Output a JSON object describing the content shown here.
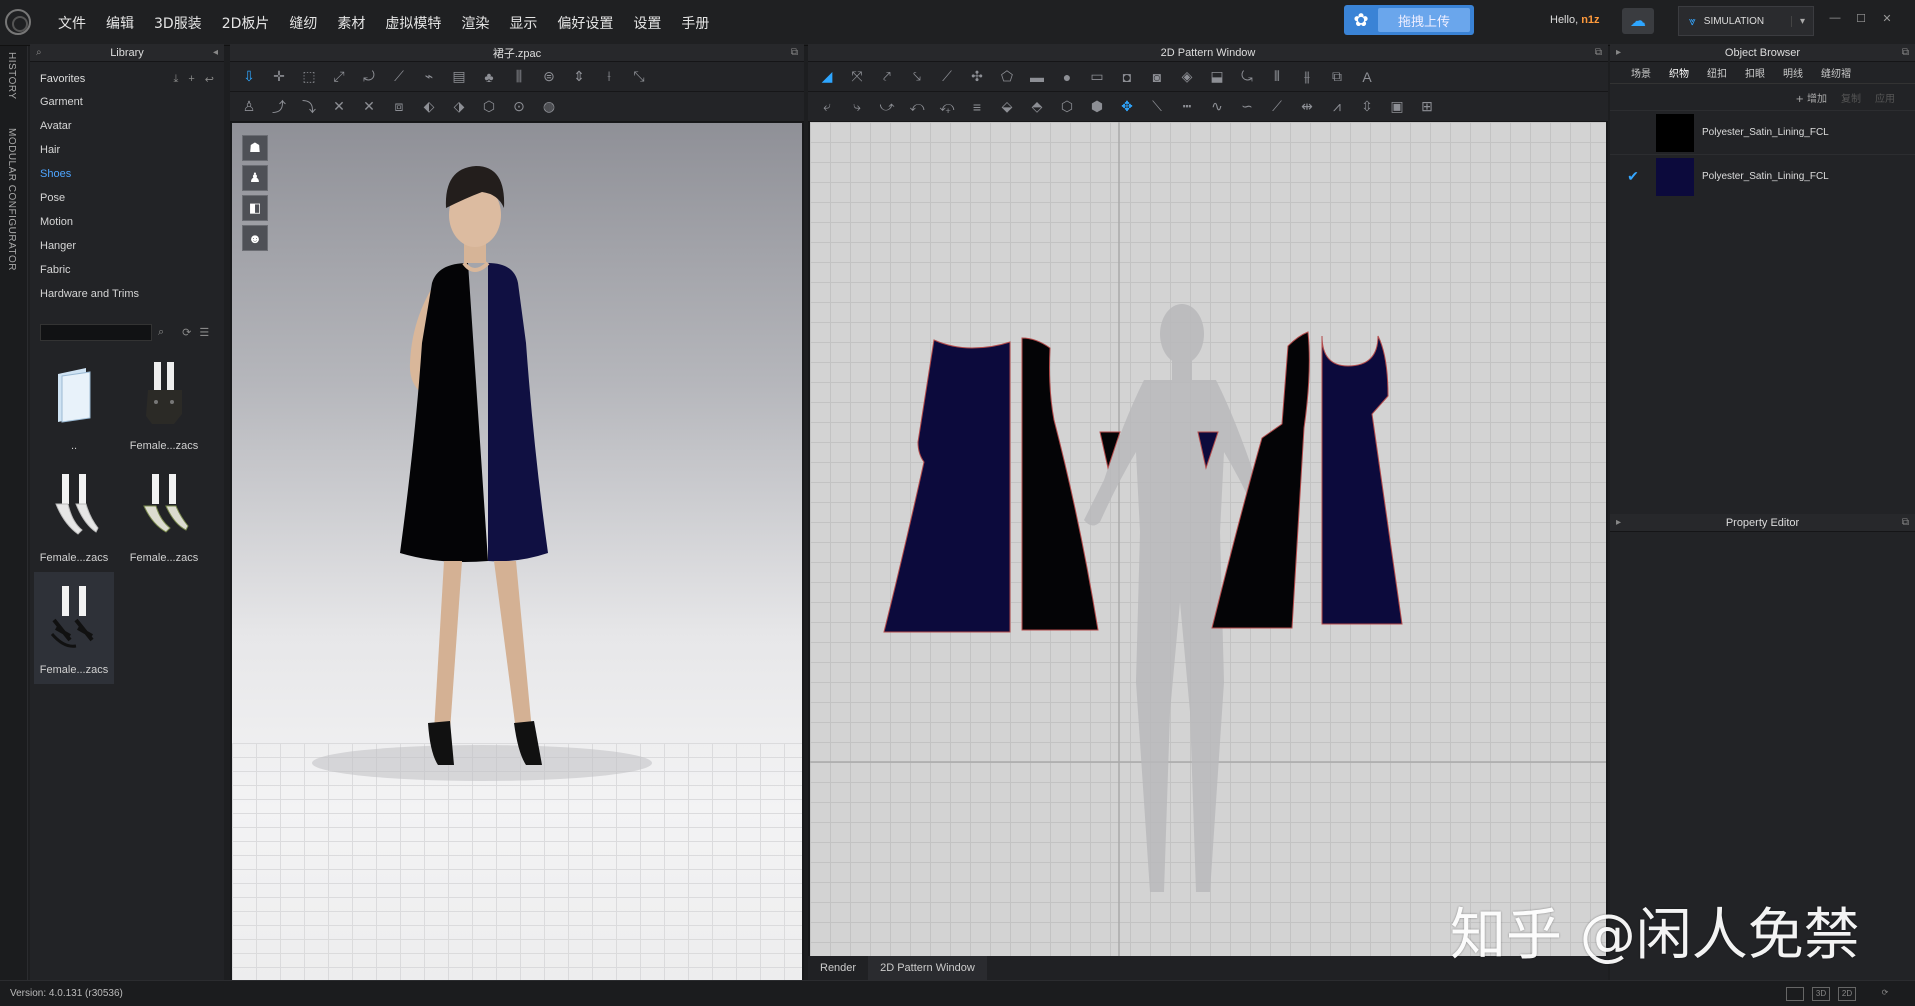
{
  "app": {
    "menu": [
      "文件",
      "编辑",
      "3D服装",
      "2D板片",
      "缝纫",
      "素材",
      "虚拟模特",
      "渲染",
      "显示",
      "偏好设置",
      "设置",
      "手册"
    ],
    "upload_label": "拖拽上传",
    "hello_prefix": "Hello,",
    "user": "n1z",
    "simulation_label": "SIMULATION",
    "window_controls": [
      "—",
      "☐",
      "✕"
    ]
  },
  "vertical_tabs": [
    "HISTORY",
    "MODULAR CONFIGURATOR"
  ],
  "library": {
    "title": "Library",
    "favorites_label": "Favorites",
    "items": [
      {
        "label": "Garment"
      },
      {
        "label": "Avatar"
      },
      {
        "label": "Hair"
      },
      {
        "label": "Shoes",
        "selected": true
      },
      {
        "label": "Pose"
      },
      {
        "label": "Motion"
      },
      {
        "label": "Hanger"
      },
      {
        "label": "Fabric"
      },
      {
        "label": "Hardware and Trims"
      }
    ],
    "search_value": "",
    "thumbnails": [
      {
        "caption": "..",
        "kind": "folder",
        "selected": false
      },
      {
        "caption": "Female...zacs",
        "kind": "boot",
        "selected": false
      },
      {
        "caption": "Female...zacs",
        "kind": "white-heel",
        "selected": false
      },
      {
        "caption": "Female...zacs",
        "kind": "green-heel",
        "selected": false
      },
      {
        "caption": "Female...zacs",
        "kind": "black-sandal",
        "selected": true
      }
    ]
  },
  "viewport3d": {
    "title": "裙子.zpac"
  },
  "pattern_window": {
    "title": "2D Pattern Window",
    "tabs": [
      {
        "label": "Render",
        "active": false
      },
      {
        "label": "2D Pattern Window",
        "active": true
      }
    ]
  },
  "object_browser": {
    "title": "Object Browser",
    "tabs": [
      {
        "label": "场景",
        "active": false
      },
      {
        "label": "织物",
        "active": true
      },
      {
        "label": "纽扣",
        "active": false
      },
      {
        "label": "扣眼",
        "active": false
      },
      {
        "label": "明线",
        "active": false
      },
      {
        "label": "缝纫褶",
        "active": false
      }
    ],
    "actions": [
      {
        "label": "+ 增加",
        "enabled": true
      },
      {
        "label": "复制",
        "enabled": false
      },
      {
        "label": "应用",
        "enabled": false
      }
    ],
    "fabrics": [
      {
        "name": "Polyester_Satin_Lining_FCL",
        "color": "#000000",
        "checked": false
      },
      {
        "name": "Polyester_Satin_Lining_FCL",
        "color": "#0c0a3c",
        "checked": true
      }
    ]
  },
  "property_editor": {
    "title": "Property Editor"
  },
  "status": {
    "version": "Version: 4.0.131 (r30536)"
  },
  "watermark": "知乎 @闲人免禁",
  "colors": {
    "accent": "#2ea6ff",
    "navy_fabric": "#0c0a3c",
    "black_fabric": "#000000",
    "upload_button": "#3a83d6",
    "username": "#ff9a3c"
  }
}
